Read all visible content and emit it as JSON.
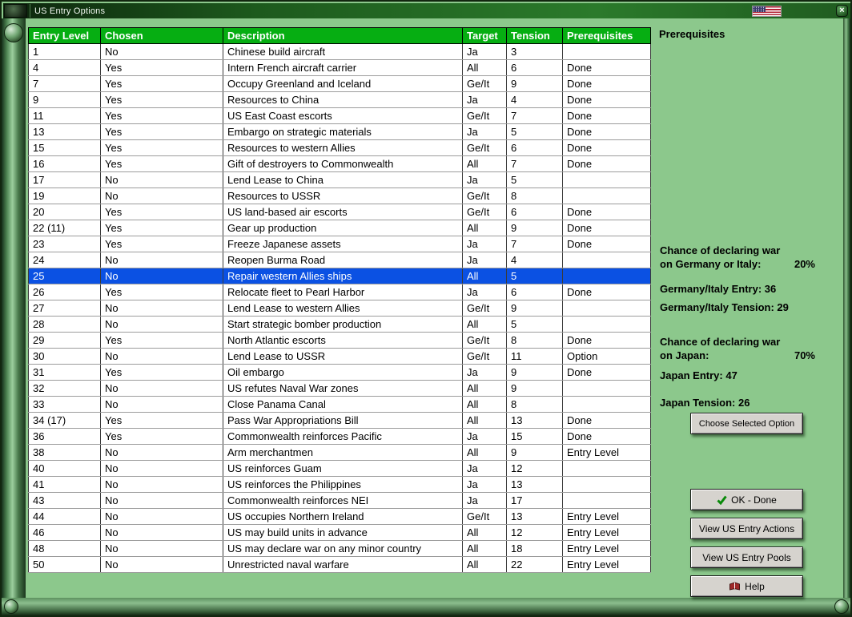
{
  "window": {
    "title": "US Entry Options",
    "close_glyph": "×"
  },
  "icons": {
    "titlebar_emblem": "app-emblem-icon",
    "flag": "us-flag-icon",
    "close": "close-icon",
    "ok_check": "green-check-icon",
    "help_book": "red-book-icon"
  },
  "table": {
    "headers": [
      "Entry Level",
      "Chosen",
      "Description",
      "Target",
      "Tension",
      "Prerequisites"
    ],
    "selected_index": 14,
    "rows": [
      [
        "1",
        "No",
        "Chinese build aircraft",
        "Ja",
        "3",
        ""
      ],
      [
        "4",
        "Yes",
        "Intern French aircraft carrier",
        "All",
        "6",
        "Done"
      ],
      [
        "7",
        "Yes",
        "Occupy Greenland and Iceland",
        "Ge/It",
        "9",
        "Done"
      ],
      [
        "9",
        "Yes",
        "Resources to China",
        "Ja",
        "4",
        "Done"
      ],
      [
        "11",
        "Yes",
        "US East Coast escorts",
        "Ge/It",
        "7",
        "Done"
      ],
      [
        "13",
        "Yes",
        "Embargo on strategic materials",
        "Ja",
        "5",
        "Done"
      ],
      [
        "15",
        "Yes",
        "Resources to western Allies",
        "Ge/It",
        "6",
        "Done"
      ],
      [
        "16",
        "Yes",
        "Gift of destroyers to Commonwealth",
        "All",
        "7",
        "Done"
      ],
      [
        "17",
        "No",
        "Lend Lease to China",
        "Ja",
        "5",
        ""
      ],
      [
        "19",
        "No",
        "Resources to USSR",
        "Ge/It",
        "8",
        ""
      ],
      [
        "20",
        "Yes",
        "US land-based air escorts",
        "Ge/It",
        "6",
        "Done"
      ],
      [
        "22 (11)",
        "Yes",
        "Gear up production",
        "All",
        "9",
        "Done"
      ],
      [
        "23",
        "Yes",
        "Freeze Japanese assets",
        "Ja",
        "7",
        "Done"
      ],
      [
        "24",
        "No",
        "Reopen Burma Road",
        "Ja",
        "4",
        ""
      ],
      [
        "25",
        "No",
        "Repair western Allies ships",
        "All",
        "5",
        ""
      ],
      [
        "26",
        "Yes",
        "Relocate fleet to Pearl Harbor",
        "Ja",
        "6",
        "Done"
      ],
      [
        "27",
        "No",
        "Lend Lease to western Allies",
        "Ge/It",
        "9",
        ""
      ],
      [
        "28",
        "No",
        "Start strategic bomber production",
        "All",
        "5",
        ""
      ],
      [
        "29",
        "Yes",
        "North Atlantic escorts",
        "Ge/It",
        "8",
        "Done"
      ],
      [
        "30",
        "No",
        "Lend Lease to USSR",
        "Ge/It",
        "11",
        "Option"
      ],
      [
        "31",
        "Yes",
        "Oil embargo",
        "Ja",
        "9",
        "Done"
      ],
      [
        "32",
        "No",
        "US refutes Naval War zones",
        "All",
        "9",
        ""
      ],
      [
        "33",
        "No",
        "Close Panama Canal",
        "All",
        "8",
        ""
      ],
      [
        "34 (17)",
        "Yes",
        "Pass War Appropriations Bill",
        "All",
        "13",
        "Done"
      ],
      [
        "36",
        "Yes",
        "Commonwealth reinforces Pacific",
        "Ja",
        "15",
        "Done"
      ],
      [
        "38",
        "No",
        "Arm merchantmen",
        "All",
        "9",
        "Entry Level"
      ],
      [
        "40",
        "No",
        "US reinforces Guam",
        "Ja",
        "12",
        ""
      ],
      [
        "41",
        "No",
        "US reinforces the Philippines",
        "Ja",
        "13",
        ""
      ],
      [
        "43",
        "No",
        "Commonwealth reinforces NEI",
        "Ja",
        "17",
        ""
      ],
      [
        "44",
        "No",
        "US occupies Northern Ireland",
        "Ge/It",
        "13",
        "Entry Level"
      ],
      [
        "46",
        "No",
        "US may build units in advance",
        "All",
        "12",
        "Entry Level"
      ],
      [
        "48",
        "No",
        "US may declare war on any minor country",
        "All",
        "18",
        "Entry Level"
      ],
      [
        "50",
        "No",
        "Unrestricted naval warfare",
        "All",
        "22",
        "Entry Level"
      ]
    ]
  },
  "sidebar": {
    "heading": "Prerequisites",
    "germany_italy": {
      "chance_line1": "Chance of declaring war",
      "chance_line2": "on Germany or Italy:",
      "chance_value": "20%",
      "entry_label": "Germany/Italy Entry:",
      "entry_value": "36",
      "tension_label": "Germany/Italy Tension:",
      "tension_value": "29"
    },
    "japan": {
      "chance_line1": "Chance of declaring war",
      "chance_line2": "on Japan:",
      "chance_value": "70%",
      "entry_label": "Japan Entry:",
      "entry_value": "47",
      "tension_label": "Japan Tension:",
      "tension_value": "26"
    },
    "buttons": {
      "choose": "Choose Selected Option",
      "ok": "OK - Done",
      "view_actions": "View US Entry Actions",
      "view_pools": "View US Entry Pools",
      "help": "Help"
    }
  },
  "colors": {
    "background_green": "#8cc88c",
    "header_green": "#06ae12",
    "selection_blue": "#0b51e3",
    "button_face": "#d6d3ce",
    "titlebar_green": "#1d5a1d"
  }
}
